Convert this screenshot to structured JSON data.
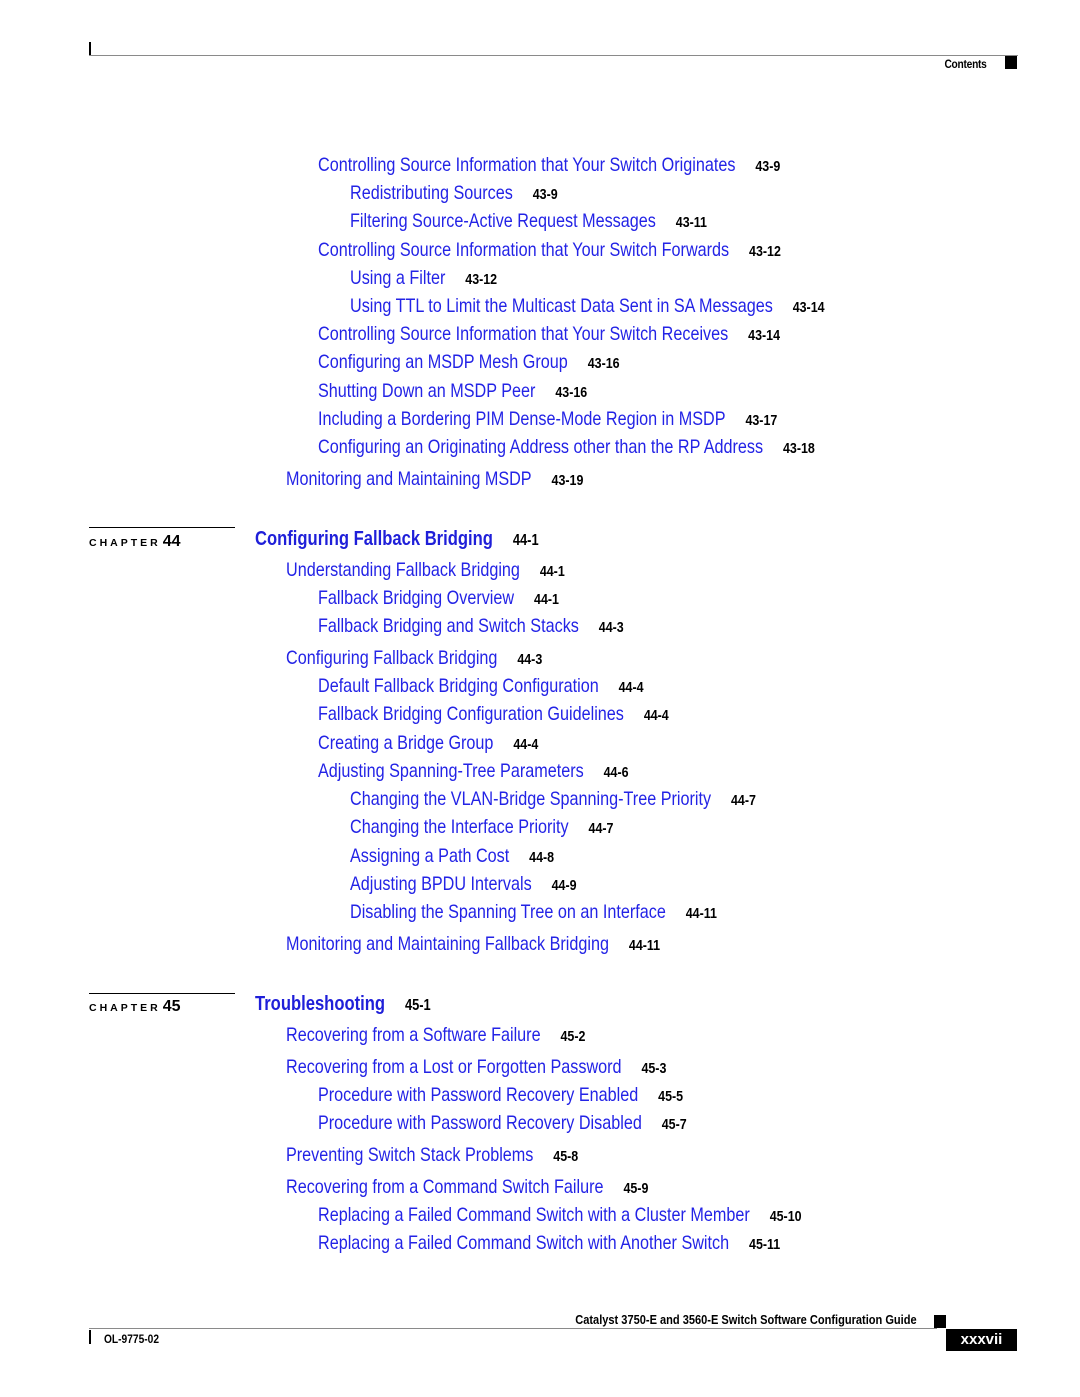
{
  "header": {
    "label": "Contents"
  },
  "entries_43": [
    {
      "text": "Controlling Source Information that Your Switch Originates",
      "page": "43-9",
      "level": 2
    },
    {
      "text": "Redistributing Sources",
      "page": "43-9",
      "level": 3
    },
    {
      "text": "Filtering Source-Active Request Messages",
      "page": "43-11",
      "level": 3
    },
    {
      "text": "Controlling Source Information that Your Switch Forwards",
      "page": "43-12",
      "level": 2
    },
    {
      "text": "Using a Filter",
      "page": "43-12",
      "level": 3
    },
    {
      "text": "Using TTL to Limit the Multicast Data Sent in SA Messages",
      "page": "43-14",
      "level": 3
    },
    {
      "text": "Controlling Source Information that Your Switch Receives",
      "page": "43-14",
      "level": 2
    },
    {
      "text": "Configuring an MSDP Mesh Group",
      "page": "43-16",
      "level": 2
    },
    {
      "text": "Shutting Down an MSDP Peer",
      "page": "43-16",
      "level": 2
    },
    {
      "text": "Including a Bordering PIM Dense-Mode Region in MSDP",
      "page": "43-17",
      "level": 2
    },
    {
      "text": "Configuring an Originating Address other than the RP Address",
      "page": "43-18",
      "level": 2
    },
    {
      "text": "Monitoring and Maintaining MSDP",
      "page": "43-19",
      "level": 1
    }
  ],
  "chapter_44": {
    "label": "CHAPTER",
    "number": "44",
    "title": "Configuring Fallback Bridging",
    "page": "44-1",
    "entries": [
      {
        "text": "Understanding Fallback Bridging",
        "page": "44-1",
        "level": 1
      },
      {
        "text": "Fallback Bridging Overview",
        "page": "44-1",
        "level": 2
      },
      {
        "text": "Fallback Bridging and Switch Stacks",
        "page": "44-3",
        "level": 2
      },
      {
        "text": "Configuring Fallback Bridging",
        "page": "44-3",
        "level": 1
      },
      {
        "text": "Default Fallback Bridging Configuration",
        "page": "44-4",
        "level": 2
      },
      {
        "text": "Fallback Bridging Configuration Guidelines",
        "page": "44-4",
        "level": 2
      },
      {
        "text": "Creating a Bridge Group",
        "page": "44-4",
        "level": 2
      },
      {
        "text": "Adjusting Spanning-Tree Parameters",
        "page": "44-6",
        "level": 2
      },
      {
        "text": "Changing the VLAN-Bridge Spanning-Tree Priority",
        "page": "44-7",
        "level": 3
      },
      {
        "text": "Changing the Interface Priority",
        "page": "44-7",
        "level": 3
      },
      {
        "text": "Assigning a Path Cost",
        "page": "44-8",
        "level": 3
      },
      {
        "text": "Adjusting BPDU Intervals",
        "page": "44-9",
        "level": 3
      },
      {
        "text": "Disabling the Spanning Tree on an Interface",
        "page": "44-11",
        "level": 3
      },
      {
        "text": "Monitoring and Maintaining Fallback Bridging",
        "page": "44-11",
        "level": 1
      }
    ]
  },
  "chapter_45": {
    "label": "CHAPTER",
    "number": "45",
    "title": "Troubleshooting",
    "page": "45-1",
    "entries": [
      {
        "text": "Recovering from a Software Failure",
        "page": "45-2",
        "level": 1
      },
      {
        "text": "Recovering from a Lost or Forgotten Password",
        "page": "45-3",
        "level": 1
      },
      {
        "text": "Procedure with Password Recovery Enabled",
        "page": "45-5",
        "level": 2
      },
      {
        "text": "Procedure with Password Recovery Disabled",
        "page": "45-7",
        "level": 2
      },
      {
        "text": "Preventing Switch Stack Problems",
        "page": "45-8",
        "level": 1
      },
      {
        "text": "Recovering from a Command Switch Failure",
        "page": "45-9",
        "level": 1
      },
      {
        "text": "Replacing a Failed Command Switch with a Cluster Member",
        "page": "45-10",
        "level": 2
      },
      {
        "text": "Replacing a Failed Command Switch with Another Switch",
        "page": "45-11",
        "level": 2
      }
    ]
  },
  "footer": {
    "doc_number": "OL-9775-02",
    "guide_title": "Catalyst 3750-E and 3560-E Switch Software Configuration Guide",
    "page_number": "xxxvii"
  }
}
